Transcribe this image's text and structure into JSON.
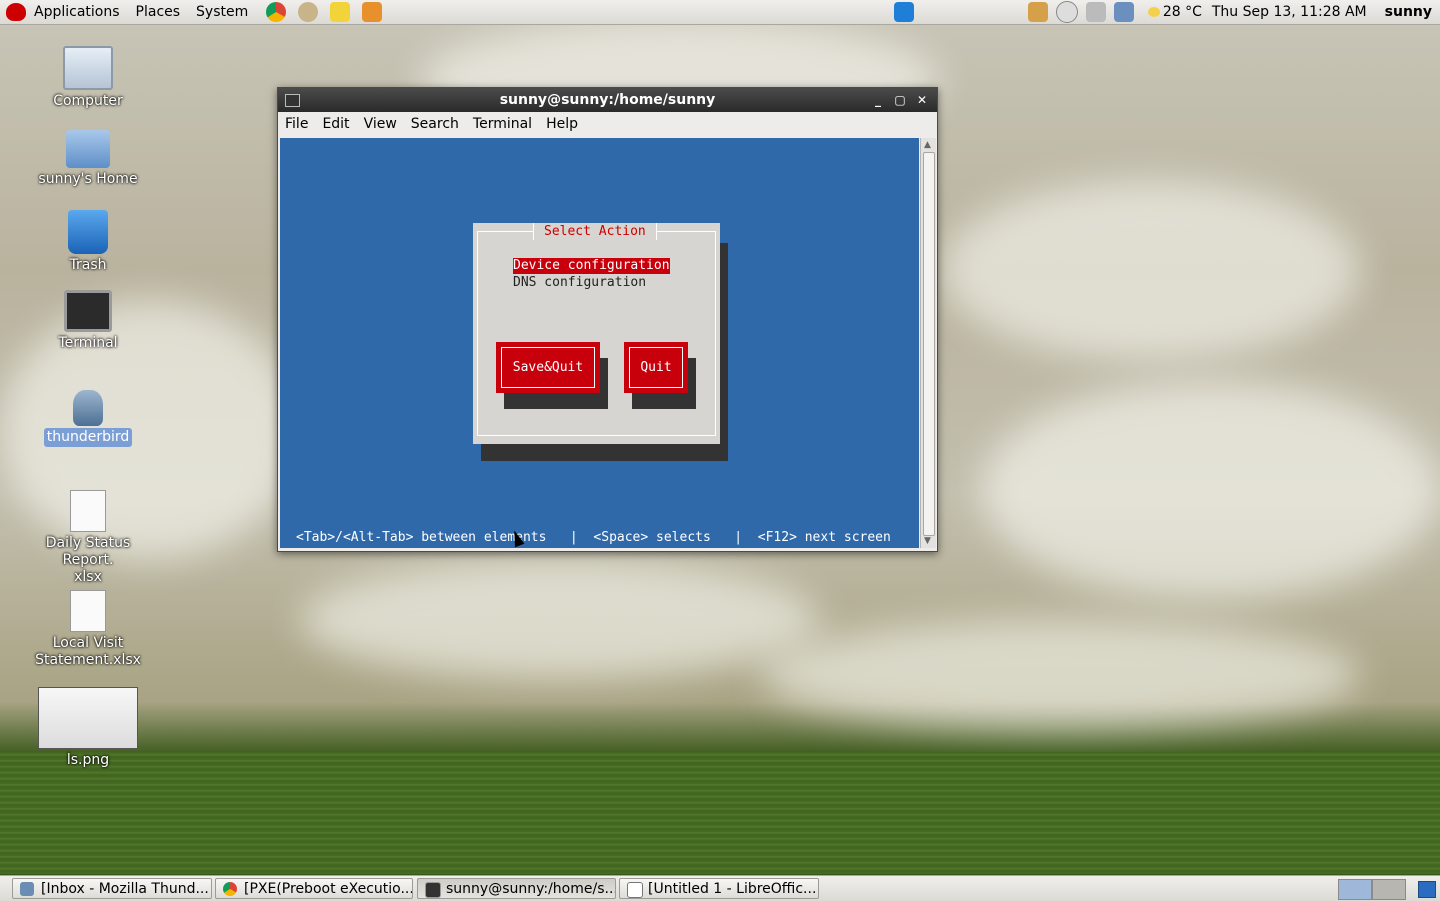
{
  "top_panel": {
    "menus": [
      "Applications",
      "Places",
      "System"
    ],
    "launchers": [
      "chrome-icon",
      "mail-icon",
      "notes-icon",
      "screenshot-icon"
    ],
    "weather": "28 °C",
    "clock": "Thu Sep 13, 11:28 AM",
    "user": "sunny"
  },
  "desktop": {
    "icons": [
      {
        "label": "Computer",
        "icon": "computer-icon"
      },
      {
        "label": "sunny's Home",
        "icon": "home-folder-icon"
      },
      {
        "label": "Trash",
        "icon": "trash-icon"
      },
      {
        "label": "Terminal",
        "icon": "terminal-icon"
      },
      {
        "label": "thunderbird",
        "icon": "thunderbird-icon"
      },
      {
        "label": "Daily Status Report.\nxlsx",
        "icon": "spreadsheet-icon"
      },
      {
        "label": "Local Visit\nStatement.xlsx",
        "icon": "spreadsheet-icon"
      },
      {
        "label": "ls.png",
        "icon": "image-thumbnail-icon"
      }
    ]
  },
  "terminal": {
    "title": "sunny@sunny:/home/sunny",
    "menus": [
      "File",
      "Edit",
      "View",
      "Search",
      "Terminal",
      "Help"
    ],
    "dialog": {
      "title": "Select Action",
      "options": [
        "Device configuration",
        "DNS configuration"
      ],
      "buttons": [
        "Save&Quit",
        "Quit"
      ]
    },
    "status": "<Tab>/<Alt-Tab> between elements   |  <Space> selects   |  <F12> next screen"
  },
  "taskbar": {
    "tasks": [
      "[Inbox - Mozilla Thund...",
      "[PXE(Preboot eXecutio...",
      "sunny@sunny:/home/s...",
      "[Untitled 1 - LibreOffic..."
    ]
  },
  "colors": {
    "terminal_bg": "#2f69aa",
    "accent_red": "#c8000c",
    "dialog_bg": "#d6d5d2"
  }
}
